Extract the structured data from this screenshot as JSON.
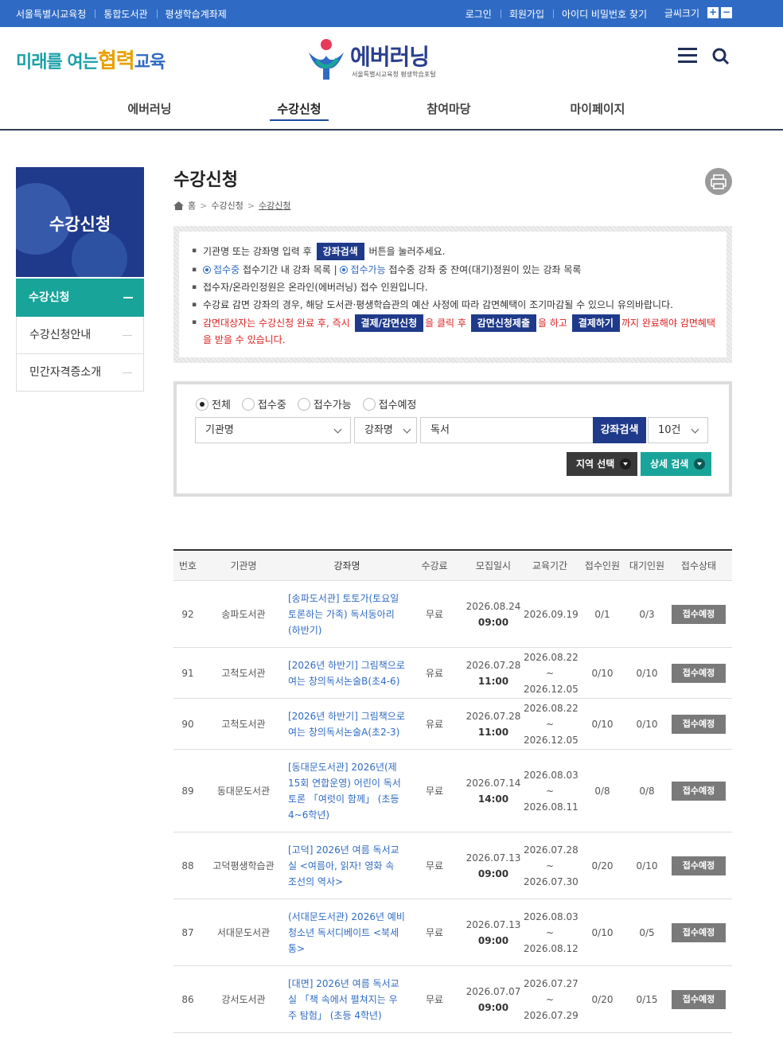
{
  "topbar": {
    "left_links": [
      "서울특별시교육청",
      "통합도서관",
      "평생학습계좌제"
    ],
    "right_links": [
      "로그인",
      "회원가입",
      "아이디 비밀번호 찾기"
    ],
    "fontsize_label": "글씨크기",
    "plus": "+",
    "minus": "−"
  },
  "header": {
    "slogan_1": "미래를 여는",
    "slogan_2": "협력",
    "slogan_3": "교육",
    "logo_text": "에버러닝",
    "logo_sub": "서울특별시교육청 평생학습포털"
  },
  "gnb": [
    "에버러닝",
    "수강신청",
    "참여마당",
    "마이페이지"
  ],
  "sidebar": {
    "title": "수강신청",
    "items": [
      {
        "label": "수강신청"
      },
      {
        "label": "수강신청안내"
      },
      {
        "label": "민간자격증소개"
      }
    ]
  },
  "page": {
    "title": "수강신청",
    "breadcrumb": [
      "홈",
      "수강신청",
      "수강신청"
    ]
  },
  "notice": {
    "l1_a": "기관명 또는 강좌명 입력 후",
    "l1_tag": "강좌검색",
    "l1_b": "버튼을 눌러주세요.",
    "l2_a": "접수중",
    "l2_b": "접수기간 내 강좌 목록 |",
    "l2_c": "접수가능",
    "l2_d": "접수중 강좌 중 잔여(대기)정원이 있는 강좌 목록",
    "l3": "접수자/온라인정원은 온라인(에버러닝) 접수 인원입니다.",
    "l4": "수강료 감면 강좌의 경우, 해당 도서관·평생학습관의 예산 사정에 따라 감면혜택이 조기마감될 수 있으니 유의바랍니다.",
    "l5_a": "감면대상자는 수강신청 완료 후, 즉시",
    "l5_tag1": "결제/감면신청",
    "l5_b": "을 클릭 후",
    "l5_tag2": "감면신청제출",
    "l5_c": "을 하고",
    "l5_tag3": "결제하기",
    "l5_d": "까지 완료해야 감면혜택",
    "l5_e": "을 받을 수 있습니다."
  },
  "search": {
    "radios": [
      "전체",
      "접수중",
      "접수가능",
      "접수예정"
    ],
    "selected_radio": 0,
    "org_select": "기관명",
    "field_select": "강좌명",
    "keyword": "독서",
    "search_button": "강좌검색",
    "count_select": "10건",
    "region_button": "지역 선택",
    "detail_button": "상세 검색"
  },
  "table": {
    "headers": [
      "번호",
      "기관명",
      "강좌명",
      "수강료",
      "모집일시",
      "교육기간",
      "접수인원",
      "대기인원",
      "접수상태"
    ],
    "rows": [
      {
        "no": "92",
        "org": "송파도서관",
        "title": "[송파도서관] 토토가(토요일 토론하는 가족) 독서동아리(하반기)",
        "fee": "무료",
        "date": "2026.08.24",
        "time": "09:00",
        "p1": "2026.09.19",
        "p2": "",
        "applied": "0/1",
        "wait": "0/3",
        "status": "접수예정"
      },
      {
        "no": "91",
        "org": "고척도서관",
        "title": "[2026년 하반기] 그림책으로 여는 창의독서논술B(초4-6)",
        "fee": "유료",
        "date": "2026.07.28",
        "time": "11:00",
        "p1": "2026.08.22 ~",
        "p2": "2026.12.05",
        "applied": "0/10",
        "wait": "0/10",
        "status": "접수예정"
      },
      {
        "no": "90",
        "org": "고척도서관",
        "title": "[2026년 하반기] 그림책으로 여는 창의독서논술A(초2-3)",
        "fee": "유료",
        "date": "2026.07.28",
        "time": "11:00",
        "p1": "2026.08.22 ~",
        "p2": "2026.12.05",
        "applied": "0/10",
        "wait": "0/10",
        "status": "접수예정"
      },
      {
        "no": "89",
        "org": "동대문도서관",
        "title": "[동대문도서관] 2026년(제15회 연합운영) 어린이 독서토론 「여럿이 함께」 (초등 4~6학년)",
        "fee": "무료",
        "date": "2026.07.14",
        "time": "14:00",
        "p1": "2026.08.03 ~",
        "p2": "2026.08.11",
        "applied": "0/8",
        "wait": "0/8",
        "status": "접수예정"
      },
      {
        "no": "88",
        "org": "고덕평생학습관",
        "title": "[고덕] 2026년 여름 독서교실 <여름아, 읽자! 영화 속 조선의 역사>",
        "fee": "무료",
        "date": "2026.07.13",
        "time": "09:00",
        "p1": "2026.07.28 ~",
        "p2": "2026.07.30",
        "applied": "0/20",
        "wait": "0/10",
        "status": "접수예정"
      },
      {
        "no": "87",
        "org": "서대문도서관",
        "title": "(서대문도서관) 2026년 예비 청소년 독서디베이트 <북세통>",
        "fee": "무료",
        "date": "2026.07.13",
        "time": "09:00",
        "p1": "2026.08.03 ~",
        "p2": "2026.08.12",
        "applied": "0/10",
        "wait": "0/5",
        "status": "접수예정"
      },
      {
        "no": "86",
        "org": "강서도서관",
        "title": "[대면] 2026년 여름 독서교실 「책 속에서 펼쳐지는 우주 탐험」 (초등 4학년)",
        "fee": "무료",
        "date": "2026.07.07",
        "time": "09:00",
        "p1": "2026.07.27 ~",
        "p2": "2026.07.29",
        "applied": "0/20",
        "wait": "0/15",
        "status": "접수예정"
      }
    ]
  },
  "colors": {
    "topbar": "#2f6bc4",
    "navy": "#1f3a8a",
    "teal": "#19a49a",
    "status_gray": "#7a7a7a"
  }
}
